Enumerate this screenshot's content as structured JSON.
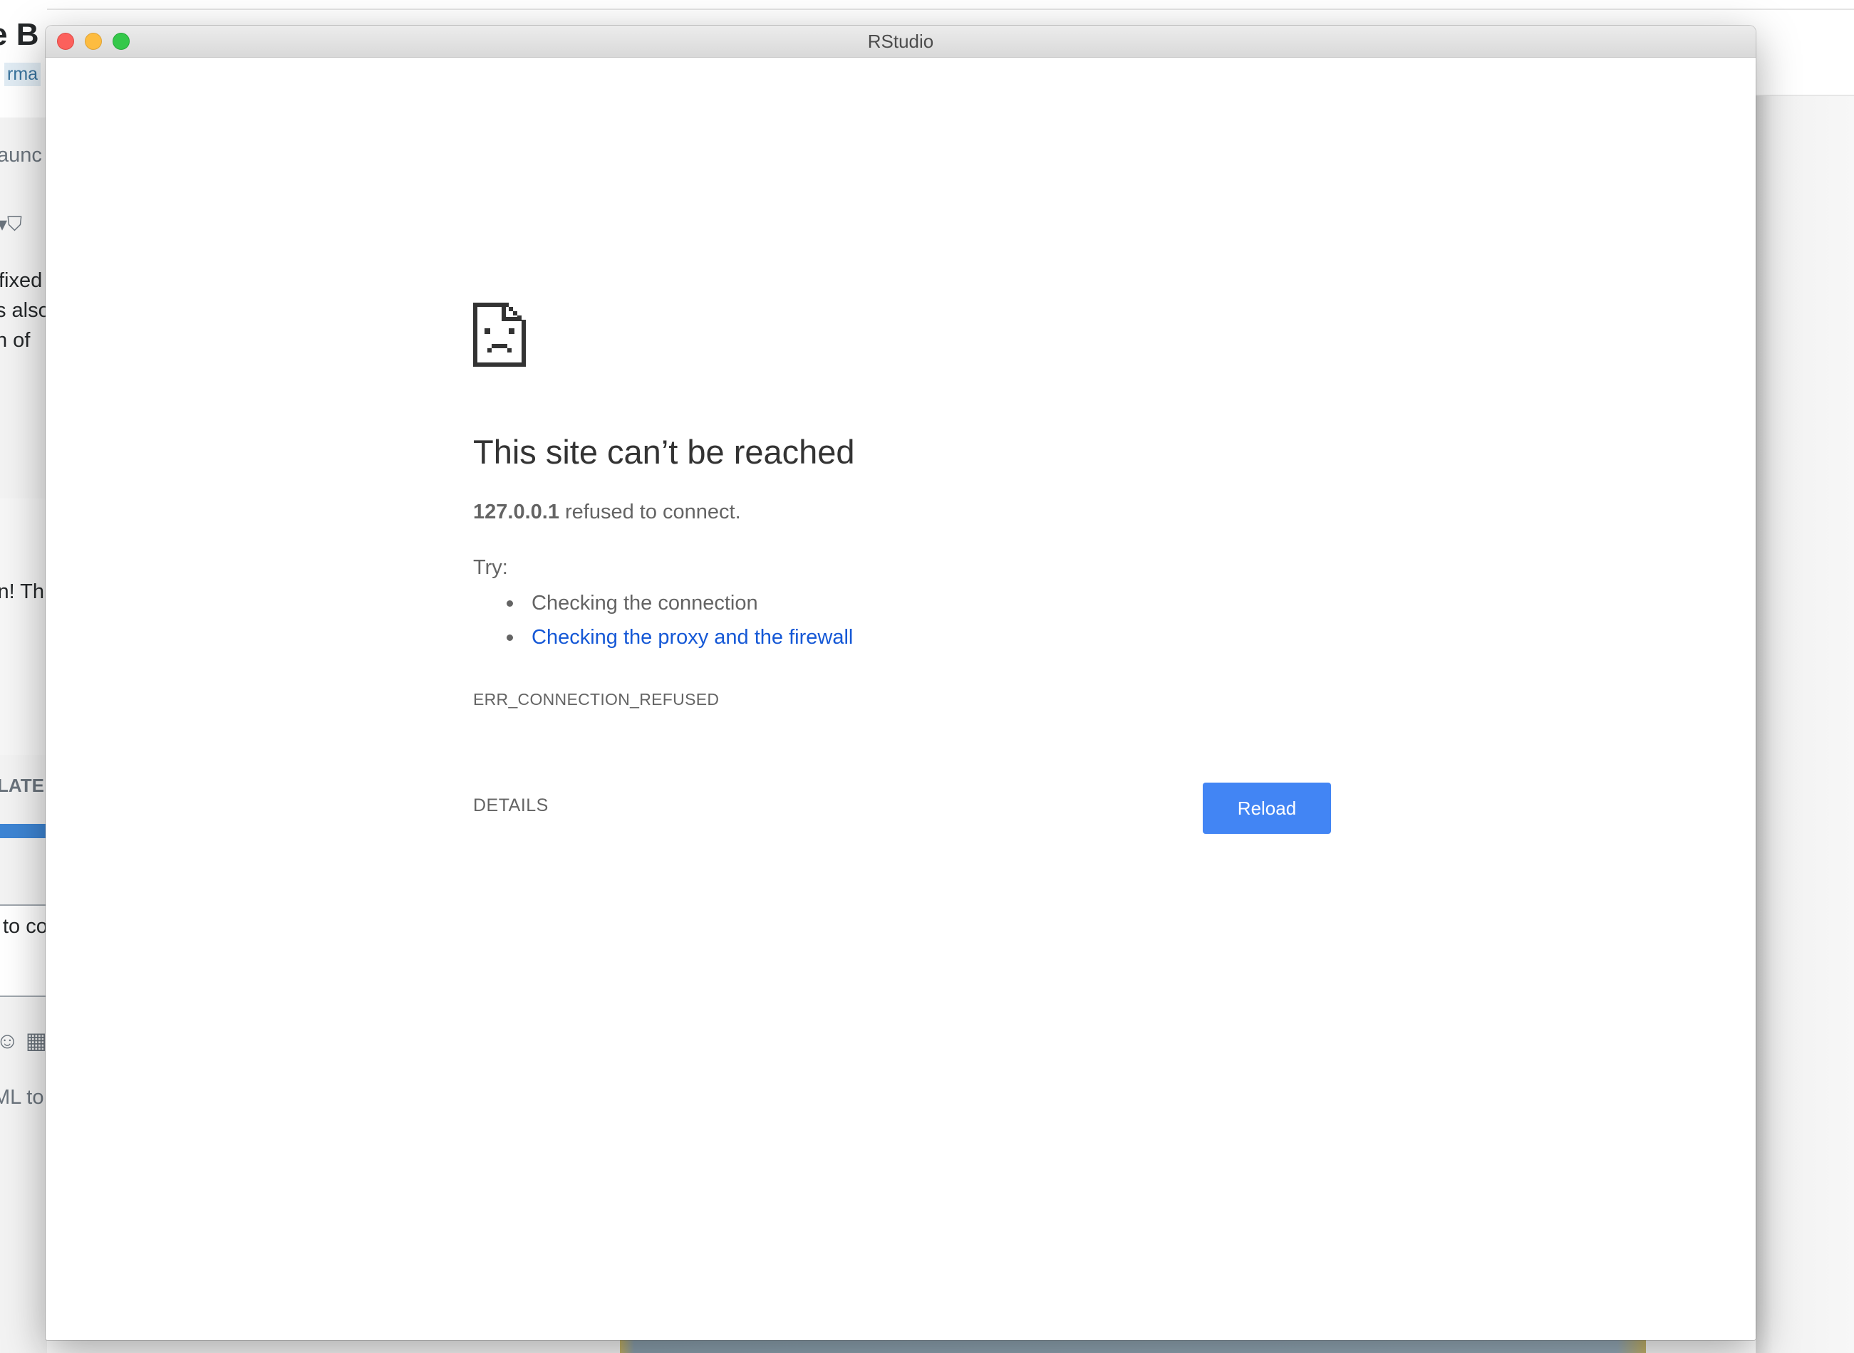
{
  "background": {
    "title_fragment": "e B",
    "tag_fragment": "rma",
    "launch_fragment": "aunc",
    "shield_fragment": "▾⛉",
    "para_line1": "fixed",
    "para_line2": "s also",
    "para_line3": "n of",
    "para_line4": "in! Th",
    "related_fragment": "LATE",
    "input_fragment": "to co",
    "icons_fragment": "☺ ▦",
    "html_fragment": "ML to"
  },
  "window": {
    "title": "RStudio"
  },
  "error_page": {
    "icon": "sad-page-icon",
    "heading": "This site can’t be reached",
    "host": "127.0.0.1",
    "summary_rest": " refused to connect.",
    "try_label": "Try:",
    "suggestions": [
      "Checking the connection",
      "Checking the proxy and the firewall"
    ],
    "error_code": "ERR_CONNECTION_REFUSED",
    "details_label": "DETAILS",
    "reload_label": "Reload"
  },
  "colors": {
    "link": "#1558d6",
    "reload_button": "#4285f4",
    "text": "#646464",
    "heading": "#333333",
    "close": "#fc605c",
    "minimize": "#fdbc40",
    "maximize": "#34c84a"
  }
}
